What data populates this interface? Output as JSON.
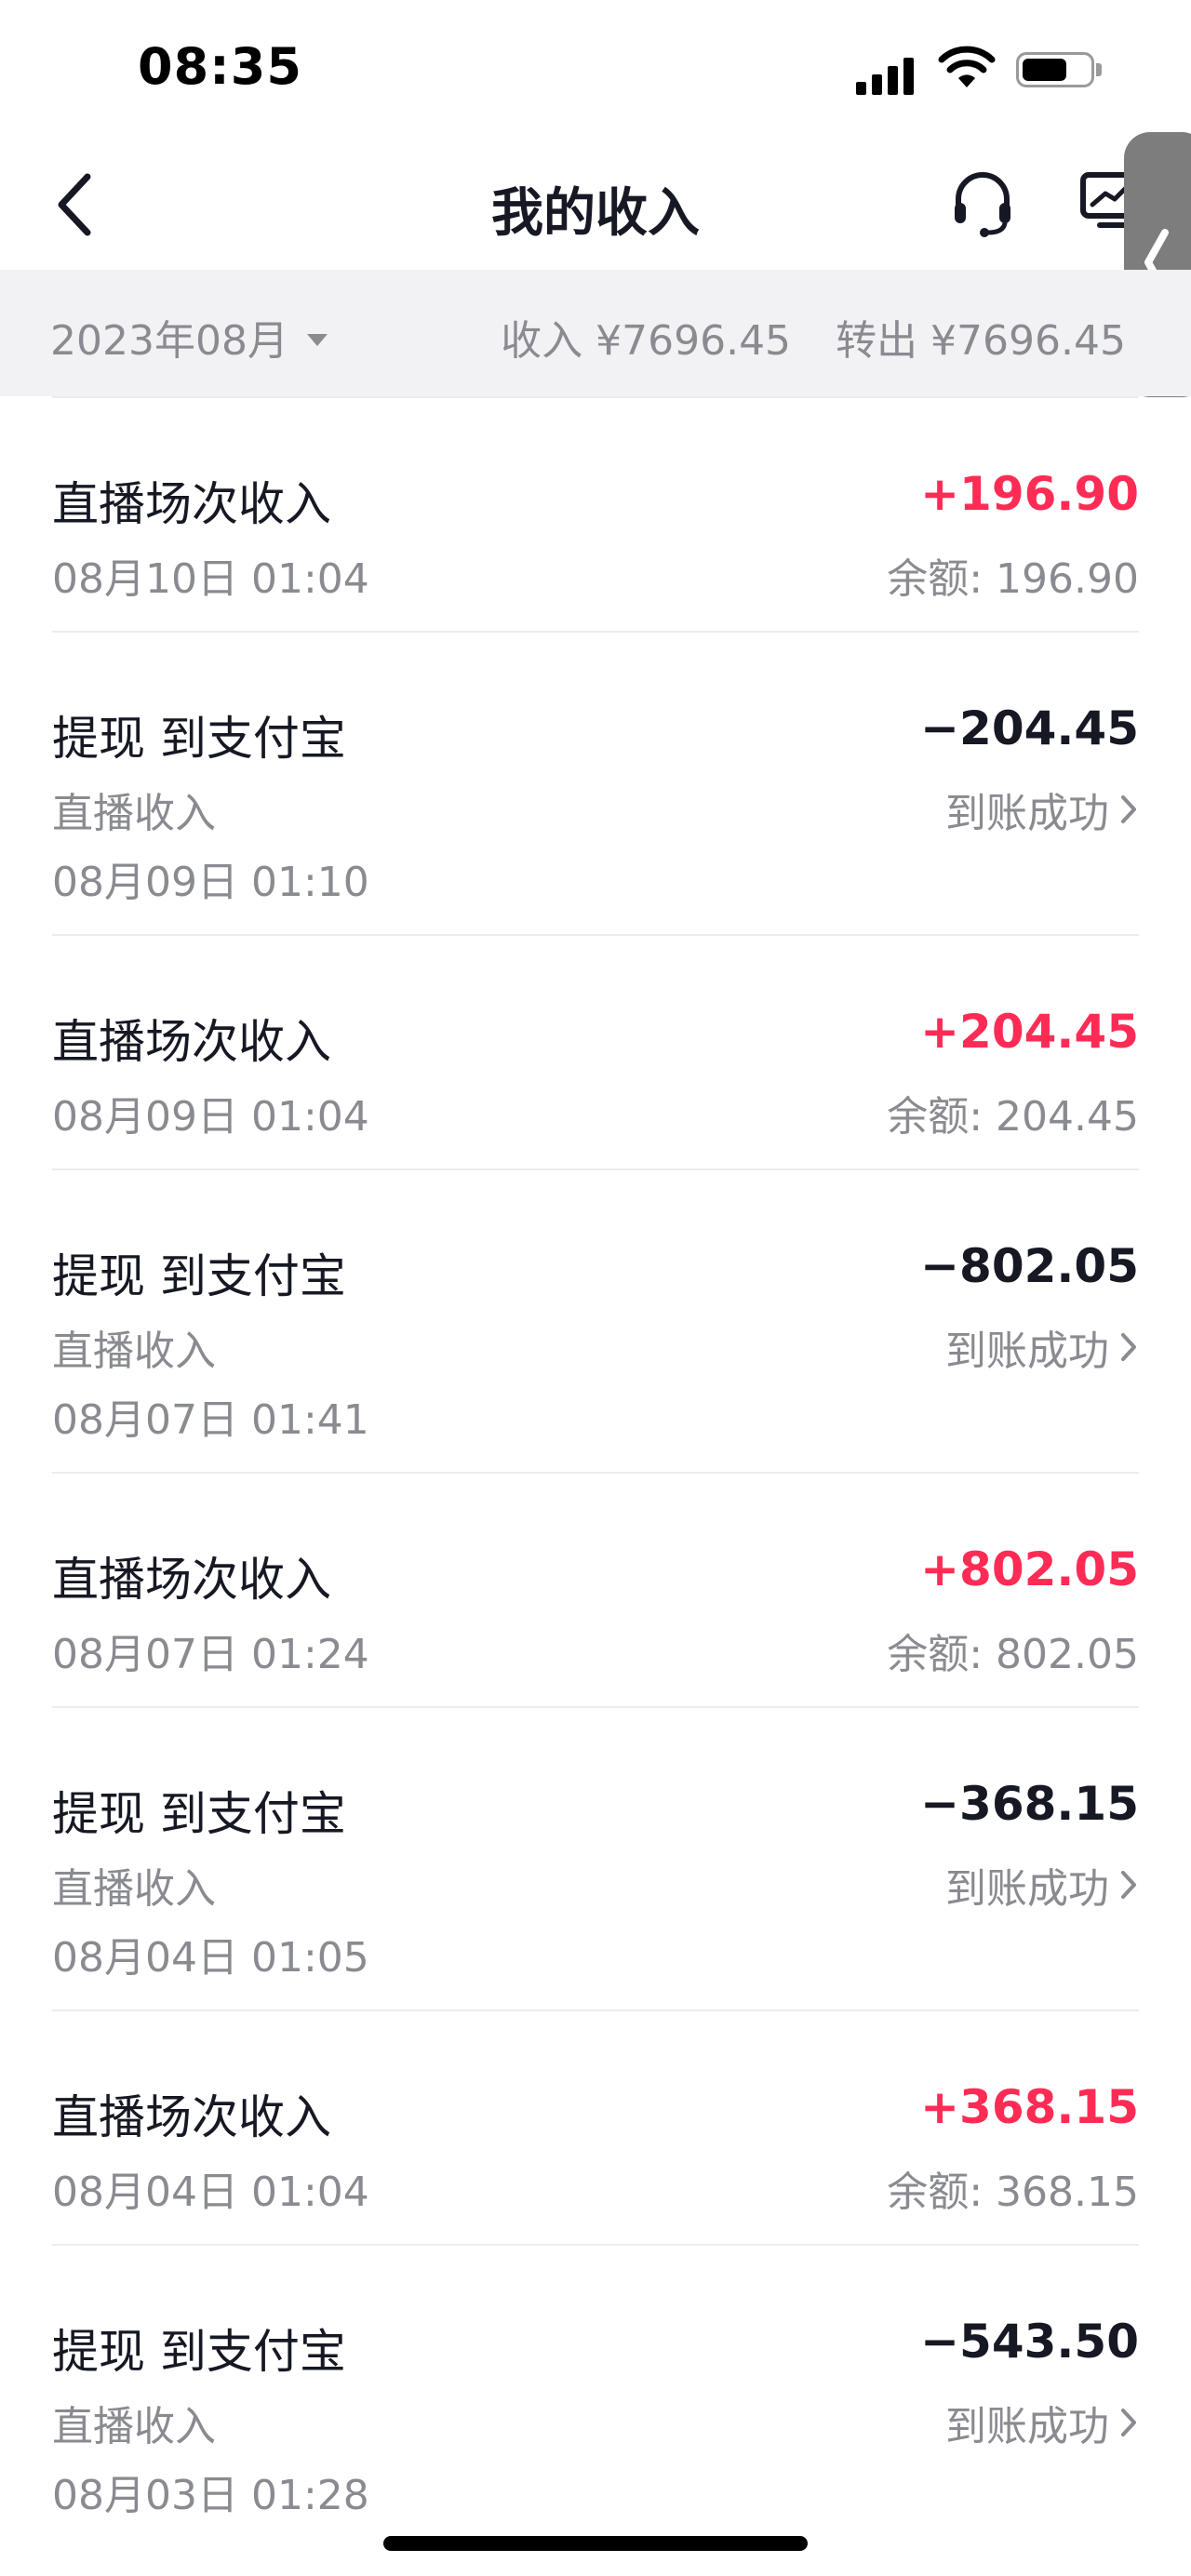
{
  "status_bar": {
    "time": "08:35"
  },
  "nav": {
    "title": "我的收入"
  },
  "summary": {
    "month": "2023年08月",
    "income": "收入 ¥7696.45",
    "out": "转出 ¥7696.45"
  },
  "colors": {
    "income_amount": "#fe2c55",
    "text_primary": "#161823",
    "text_secondary": "#8a8b91"
  },
  "records": [
    {
      "title": "直播场次收入",
      "time": "08月10日 01:04",
      "amount": "+196.90",
      "balance": "余额: 196.90"
    },
    {
      "title": "提现 到支付宝",
      "subtitle": "直播收入",
      "time": "08月09日 01:10",
      "amount": "−204.45",
      "status": "到账成功"
    },
    {
      "title": "直播场次收入",
      "time": "08月09日 01:04",
      "amount": "+204.45",
      "balance": "余额: 204.45"
    },
    {
      "title": "提现 到支付宝",
      "subtitle": "直播收入",
      "time": "08月07日 01:41",
      "amount": "−802.05",
      "status": "到账成功"
    },
    {
      "title": "直播场次收入",
      "time": "08月07日 01:24",
      "amount": "+802.05",
      "balance": "余额: 802.05"
    },
    {
      "title": "提现 到支付宝",
      "subtitle": "直播收入",
      "time": "08月04日 01:05",
      "amount": "−368.15",
      "status": "到账成功"
    },
    {
      "title": "直播场次收入",
      "time": "08月04日 01:04",
      "amount": "+368.15",
      "balance": "余额: 368.15"
    },
    {
      "title": "提现 到支付宝",
      "subtitle": "直播收入",
      "time": "08月03日 01:28",
      "amount": "−543.50",
      "status": "到账成功"
    }
  ]
}
